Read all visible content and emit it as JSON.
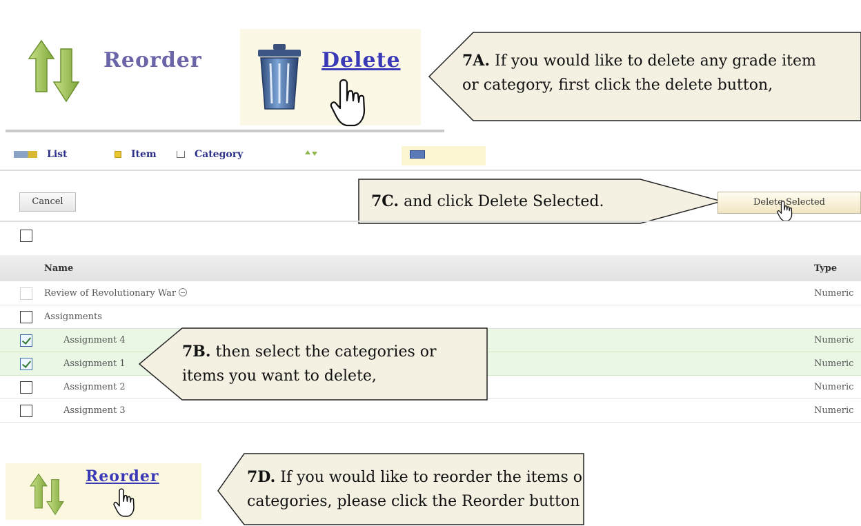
{
  "zoom_top": {
    "reorder_label": "Reorder",
    "delete_label": "Delete"
  },
  "callouts": {
    "c7a": {
      "tag": "7A.",
      "line1": " If you would like to delete any grade item",
      "line2": "or category, first click the delete button,"
    },
    "c7b": {
      "tag": "7B.",
      "line1": " then select the categories or",
      "line2": "items you want to delete,"
    },
    "c7c": {
      "tag": "7C.",
      "line1": " and click Delete Selected."
    },
    "c7d": {
      "tag": "7D.",
      "line1": " If you would like to reorder the items or",
      "line2": "categories, please click the Reorder button"
    }
  },
  "toolbar": {
    "list_label": "List",
    "item_label": "Item",
    "category_label": "Category"
  },
  "buttons": {
    "cancel": "Cancel",
    "delete_selected": "Delete Selected"
  },
  "table": {
    "headers": {
      "name": "Name",
      "type": "Type"
    },
    "rows": [
      {
        "name": "Review of Revolutionary War",
        "type": "Numeric",
        "checked": false
      },
      {
        "name": "Assignments",
        "type": "",
        "checked": false
      },
      {
        "name": "Assignment 4",
        "type": "Numeric",
        "checked": true
      },
      {
        "name": "Assignment 1",
        "type": "Numeric",
        "checked": true
      },
      {
        "name": "Assignment 2",
        "type": "Numeric",
        "checked": false
      },
      {
        "name": "Assignment 3",
        "type": "Numeric",
        "checked": false
      }
    ]
  },
  "zoom_bottom": {
    "reorder_label": "Reorder"
  },
  "colors": {
    "callout_fill": "#f4f1e3",
    "selected_row": "#eaf7e4",
    "link_blue": "#3a3ab8",
    "arrow_green": "#8fb84a"
  }
}
